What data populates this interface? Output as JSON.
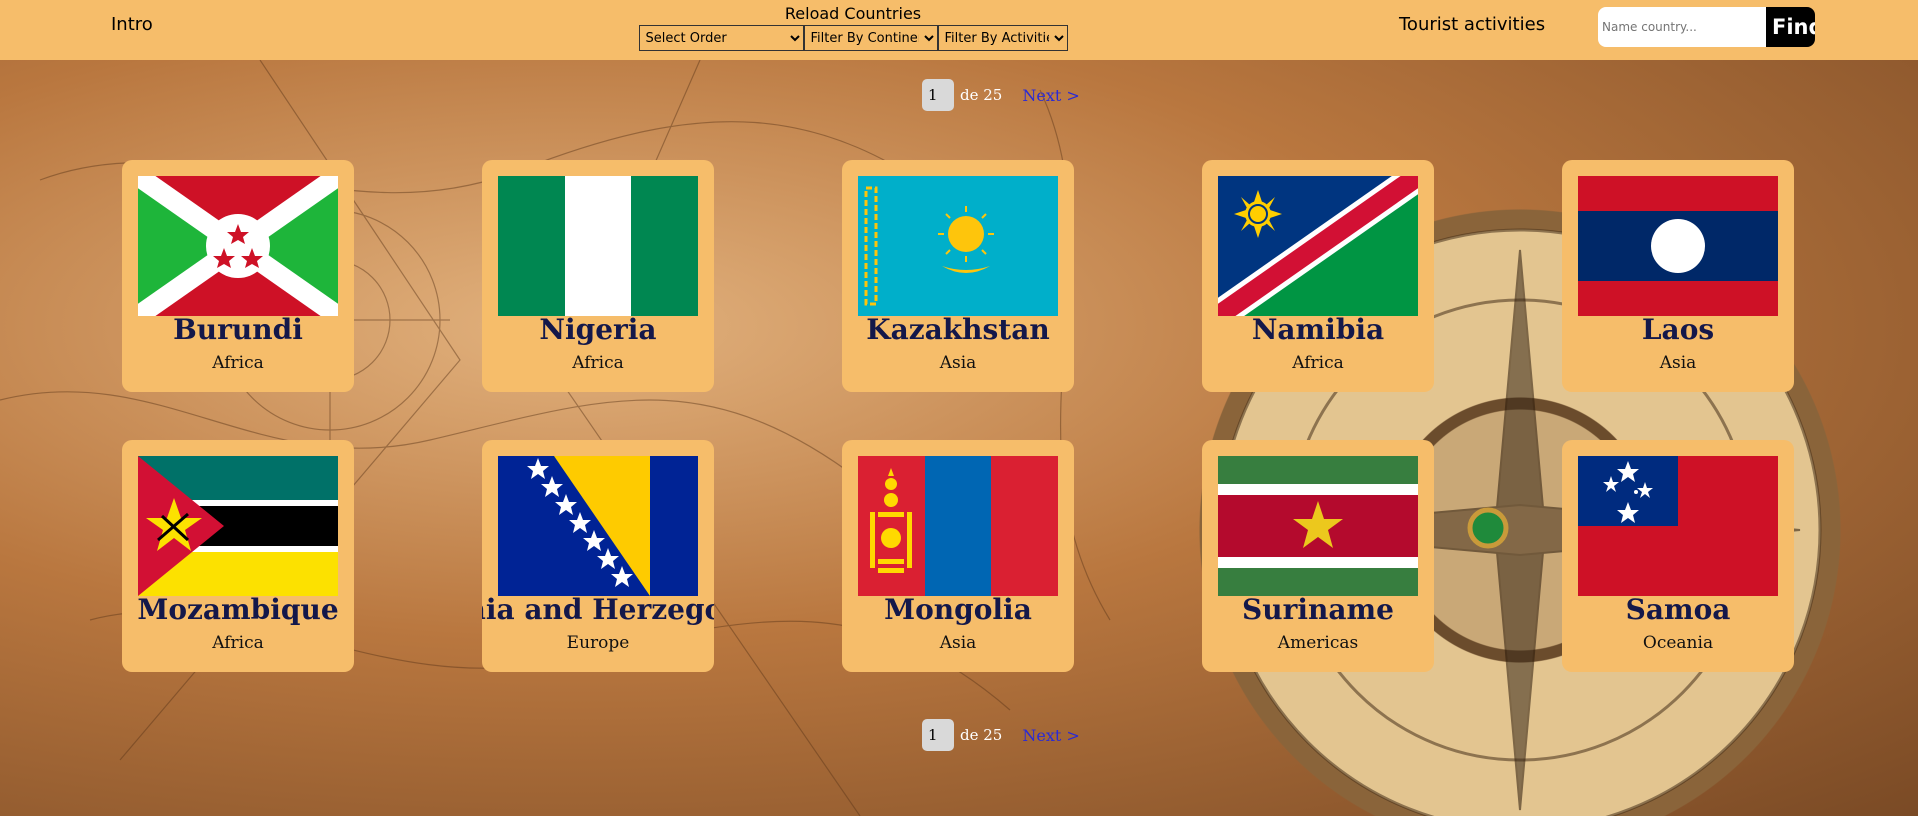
{
  "nav": {
    "intro": "Intro",
    "reload": "Reload Countries",
    "order_select": "Select Order",
    "continent_select": "Filter By Continent",
    "activities_select": "Filter By Activities",
    "activities_link": "Tourist activities",
    "search_placeholder": "Name country...",
    "find_button": "Find"
  },
  "pagination": {
    "current": "1",
    "of_text": "de 25",
    "next": "Next >"
  },
  "countries": [
    {
      "name": "Burundi",
      "continent": "Africa",
      "flag": "burundi-flag"
    },
    {
      "name": "Nigeria",
      "continent": "Africa",
      "flag": "nigeria-flag"
    },
    {
      "name": "Kazakhstan",
      "continent": "Asia",
      "flag": "kazakhstan-flag"
    },
    {
      "name": "Namibia",
      "continent": "Africa",
      "flag": "namibia-flag"
    },
    {
      "name": "Laos",
      "continent": "Asia",
      "flag": "laos-flag"
    },
    {
      "name": "Mozambique",
      "continent": "Africa",
      "flag": "mozambique-flag"
    },
    {
      "name": "Bosnia and Herzegovina",
      "continent": "Europe",
      "flag": "bosnia-flag"
    },
    {
      "name": "Mongolia",
      "continent": "Asia",
      "flag": "mongolia-flag"
    },
    {
      "name": "Suriname",
      "continent": "Americas",
      "flag": "suriname-flag"
    },
    {
      "name": "Samoa",
      "continent": "Oceania",
      "flag": "samoa-flag"
    }
  ],
  "colors": {
    "nav_bg": "#f6bd6a",
    "card_bg": "#f6bd6a",
    "name_text": "#14184a",
    "next_link": "#2a2ad6"
  }
}
